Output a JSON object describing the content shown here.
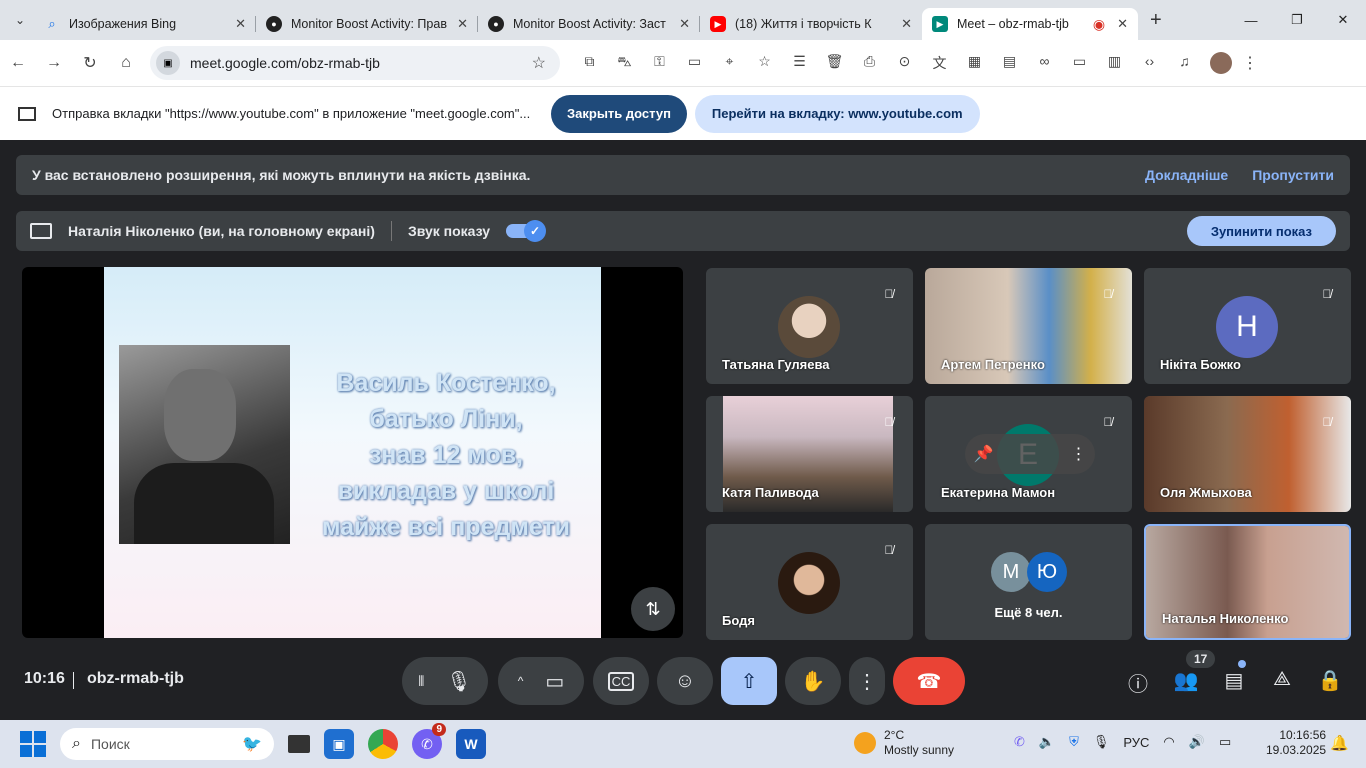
{
  "browser": {
    "tabs": [
      {
        "title": "Изображения Bing",
        "icon": "search-icon",
        "color": "#1a73e8"
      },
      {
        "title": "Monitor Boost Activity: Прав",
        "icon": "monitor-boost-icon",
        "color": "#222"
      },
      {
        "title": "Monitor Boost Activity: Заст",
        "icon": "monitor-boost-icon",
        "color": "#222"
      },
      {
        "title": "(18) Життя і творчість К",
        "icon": "youtube-icon",
        "color": "#ff0000"
      },
      {
        "title": "Meet – obz-rmab-tjb",
        "icon": "meet-icon",
        "color": "#00897b",
        "active": true
      }
    ],
    "url": "meet.google.com/obz-rmab-tjb"
  },
  "infobar": {
    "text": "Отправка вкладки \"https://www.youtube.com\" в приложение \"meet.google.com\"...",
    "stop_label": "Закрыть доступ",
    "goto_label": "Перейти на вкладку: www.youtube.com"
  },
  "meet": {
    "warning": {
      "text": "У вас встановлено розширення, які можуть вплинути на якість дзвінка.",
      "more": "Докладніше",
      "skip": "Пропустити"
    },
    "presenting": {
      "who": "Наталія Ніколенко (ви, на головному екрані)",
      "audio_label": "Звук показу",
      "audio_on": true,
      "stop_label": "Зупинити показ"
    },
    "slide_text": [
      "Василь Костенко,",
      "батько Ліни,",
      "знав 12 мов,",
      "викладав у школі",
      "майже всі предмети"
    ],
    "participants": [
      {
        "name": "Татьяна Гуляева",
        "muted": true
      },
      {
        "name": "Артем Петренко",
        "muted": true
      },
      {
        "name": "Нікіта Божко",
        "muted": true,
        "initial": "Н",
        "color": "#5c6bc0"
      },
      {
        "name": "Катя Паливода",
        "muted": true
      },
      {
        "name": "Екатерина Мамон",
        "muted": true,
        "initial": "Е",
        "color": "#00796b"
      },
      {
        "name": "Оля Жмыхова",
        "muted": true
      },
      {
        "name": "Бодя",
        "muted": true
      },
      {
        "name": "Наталья Николенко",
        "muted": false
      }
    ],
    "more": {
      "initials": [
        "М",
        "Ю"
      ],
      "label": "Ещё 8 чел."
    },
    "time": "10:16",
    "code": "obz-rmab-tjb",
    "people_count": "17"
  },
  "taskbar": {
    "search_placeholder": "Поиск",
    "viber_badge": "9",
    "weather_temp": "2°C",
    "weather_desc": "Mostly sunny",
    "lang": "РУС",
    "clock_time": "10:16:56",
    "clock_date": "19.03.2025"
  }
}
